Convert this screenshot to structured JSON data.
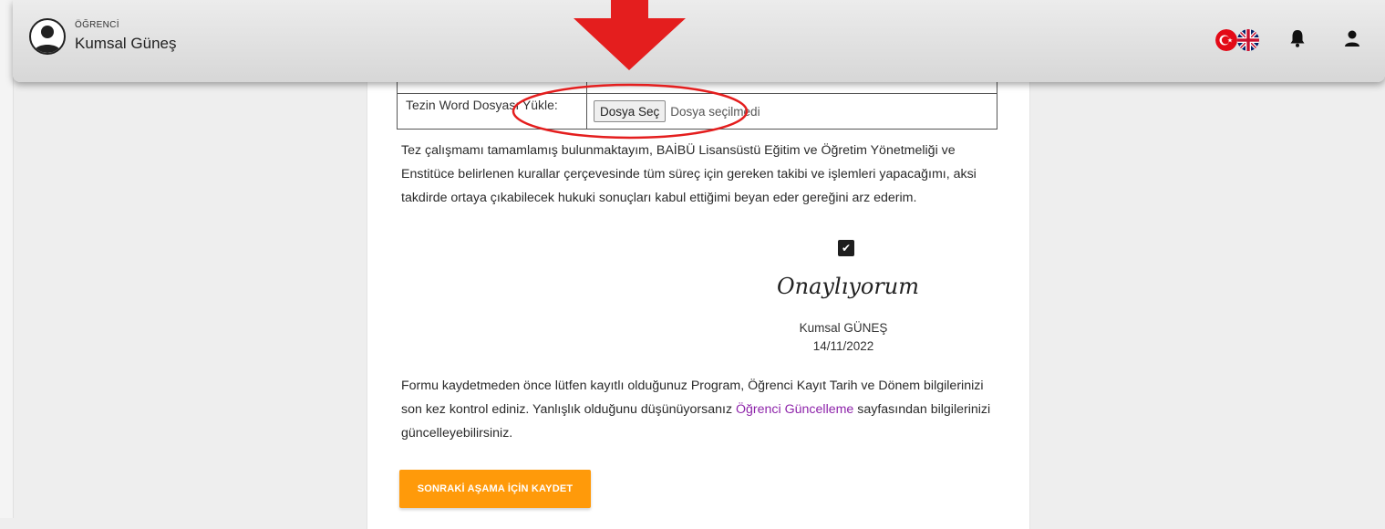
{
  "header": {
    "role": "ÖĞRENCİ",
    "user_name": "Kumsal Güneş",
    "icons": [
      "avatar-icon",
      "turkish-flag-icon",
      "uk-flag-icon",
      "bell-icon",
      "user-icon"
    ]
  },
  "upload": {
    "label": "Tezin Word Dosyası Yükle:",
    "button_label": "Dosya Seç",
    "status": "Dosya seçilmedi"
  },
  "declaration": {
    "text": "Tez çalışmamı tamamlamış bulunmaktayım, BAİBÜ Lisansüstü Eğitim ve Öğretim Yönetmeliği ve Enstitüce belirlenen kurallar çerçevesinde tüm süreç için gereken takibi ve işlemleri yapacağımı, aksi takdirde ortaya çıkabilecek hukuki sonuçları kabul ettiğimi beyan eder gereğini arz ederim."
  },
  "approval": {
    "checked": true,
    "signature_text": "Onaylıyorum",
    "name": "Kumsal GÜNEŞ",
    "date": "14/11/2022"
  },
  "notice": {
    "before_link": "Formu kaydetmeden önce lütfen kayıtlı olduğunuz Program, Öğrenci Kayıt Tarih ve Dönem bilgilerinizi son kez kontrol ediniz. Yanlışlık olduğunu düşünüyorsanız ",
    "link_text": "Öğrenci Güncelleme",
    "after_link": " sayfasından bilgilerinizi güncelleyebilirsiniz."
  },
  "save_button": "SONRAKİ AŞAMA İÇİN KAYDET",
  "colors": {
    "accent_orange": "#ff9a0a",
    "link_purple": "#8e24aa",
    "annotation_red": "#e41e1e"
  }
}
